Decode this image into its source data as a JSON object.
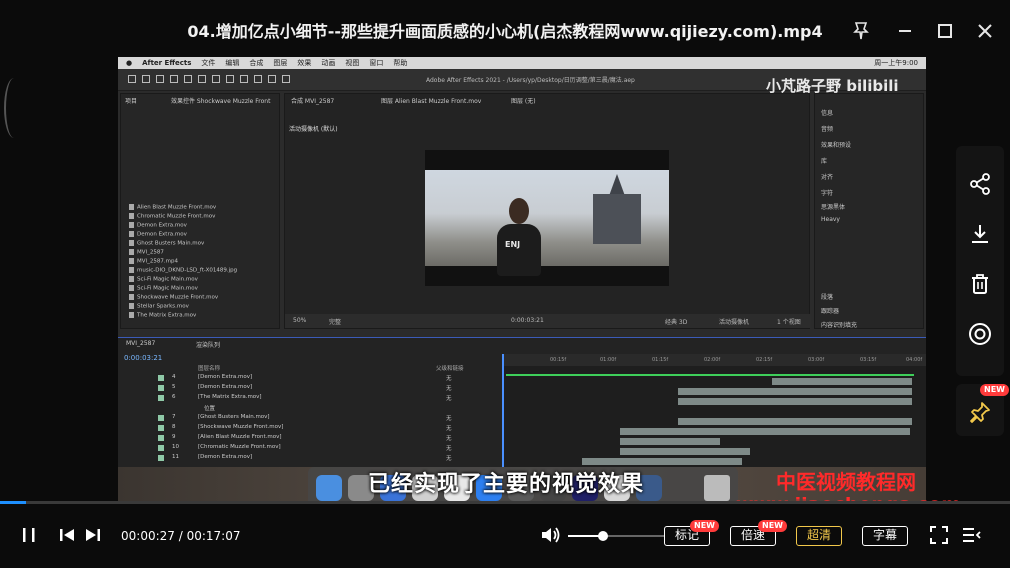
{
  "window": {
    "title": "04.增加亿点小细节--那些提升画面质感的小心机(启杰教程网www.qijiezy.com).mp4",
    "pin_icon": "pin-icon",
    "minimize_icon": "minimize-icon",
    "maximize_icon": "maximize-icon",
    "close_icon": "close-icon"
  },
  "video_frame": {
    "app_menu": [
      "After Effects",
      "文件",
      "编辑",
      "合成",
      "图层",
      "效果",
      "动画",
      "视图",
      "窗口",
      "帮助"
    ],
    "app_title": "Adobe After Effects 2021 - /Users/yp/Desktop/日历调整/第三晨/魔法.aep",
    "clock": "周一上午9:00",
    "project_tab": "项目",
    "effects_tab": "效果控件 Shockwave Muzzle Front",
    "comp_tabs": [
      "合成 MVI_2587",
      "图层 Alien Blast Muzzle Front.mov",
      "图层 (无)"
    ],
    "comp_label": "活动摄像机 (默认)",
    "project_items": [
      "Alien Blast Muzzle Front.mov",
      "Chromatic Muzzle Front.mov",
      "Demon Extra.mov",
      "Demon Extra.mov",
      "Ghost Busters Main.mov",
      "MVI_2587",
      "MVI_2587.mp4",
      "music-DIO_DKND-LSD_ft-X01489.jpg",
      "Sci-Fi Magic Main.mov",
      "Sci-Fi Magic Main.mov",
      "Shockwave Muzzle Front.mov",
      "Stellar Sparks.mov",
      "The Matrix Extra.mov"
    ],
    "shirt_text": "ENJ",
    "right_panel_items": [
      "信息",
      "音频",
      "效果和预设",
      "库",
      "对齐",
      "字符",
      "思源黑体",
      "Heavy",
      "段落",
      "跟踪器",
      "内容识别填充"
    ],
    "viewer_bar": [
      "50%",
      "完整",
      "0:00:03:21",
      "经典 3D",
      "活动摄像机",
      "1 个视图"
    ],
    "timeline_tab": "MVI_2587",
    "render_queue_tab": "渲染队列",
    "timecode": "0:00:03:21",
    "layer_header": "图层名称",
    "parent_header": "父级和链接",
    "layers": [
      {
        "num": "4",
        "name": "[Demon Extra.mov]",
        "mode": "无"
      },
      {
        "num": "5",
        "name": "[Demon Extra.mov]",
        "mode": "无"
      },
      {
        "num": "6",
        "name": "[The Matrix Extra.mov]",
        "mode": "无"
      },
      {
        "num": "",
        "name": "位置",
        "mode": ""
      },
      {
        "num": "7",
        "name": "[Ghost Busters Main.mov]",
        "mode": "无"
      },
      {
        "num": "8",
        "name": "[Shockwave Muzzle Front.mov]",
        "mode": "无"
      },
      {
        "num": "9",
        "name": "[Alien Blast Muzzle Front.mov]",
        "mode": "无"
      },
      {
        "num": "10",
        "name": "[Chromatic Muzzle Front.mov]",
        "mode": "无"
      },
      {
        "num": "11",
        "name": "[Demon Extra.mov]",
        "mode": "无"
      }
    ],
    "ruler_ticks": [
      "00:15f",
      "01:00f",
      "01:15f",
      "02:00f",
      "02:15f",
      "03:00f",
      "03:15f",
      "04:00f"
    ],
    "watermark": "小芃路子野 bilibili"
  },
  "subtitle": "已经实现了主要的视觉效果",
  "brand_lines": [
    "中医视频教程网",
    "www.jiaochengs.com"
  ],
  "side_actions": [
    {
      "name": "share-icon"
    },
    {
      "name": "download-icon"
    },
    {
      "name": "delete-icon"
    },
    {
      "name": "focus-icon"
    }
  ],
  "pin_badge": "NEW",
  "playback": {
    "current_time": "00:00:27",
    "total_time": "00:17:07",
    "time_display": "00:00:27 / 00:17:07",
    "progress": 0.026,
    "volume": 0.36
  },
  "buttons": {
    "bookmark": "标记",
    "speed": "倍速",
    "quality": "超清",
    "subtitles": "字幕",
    "new_badge": "NEW"
  },
  "colors": {
    "accent": "#1e90ff",
    "brand_red": "#ff2a2a",
    "badge_red": "#ff3b3b"
  }
}
